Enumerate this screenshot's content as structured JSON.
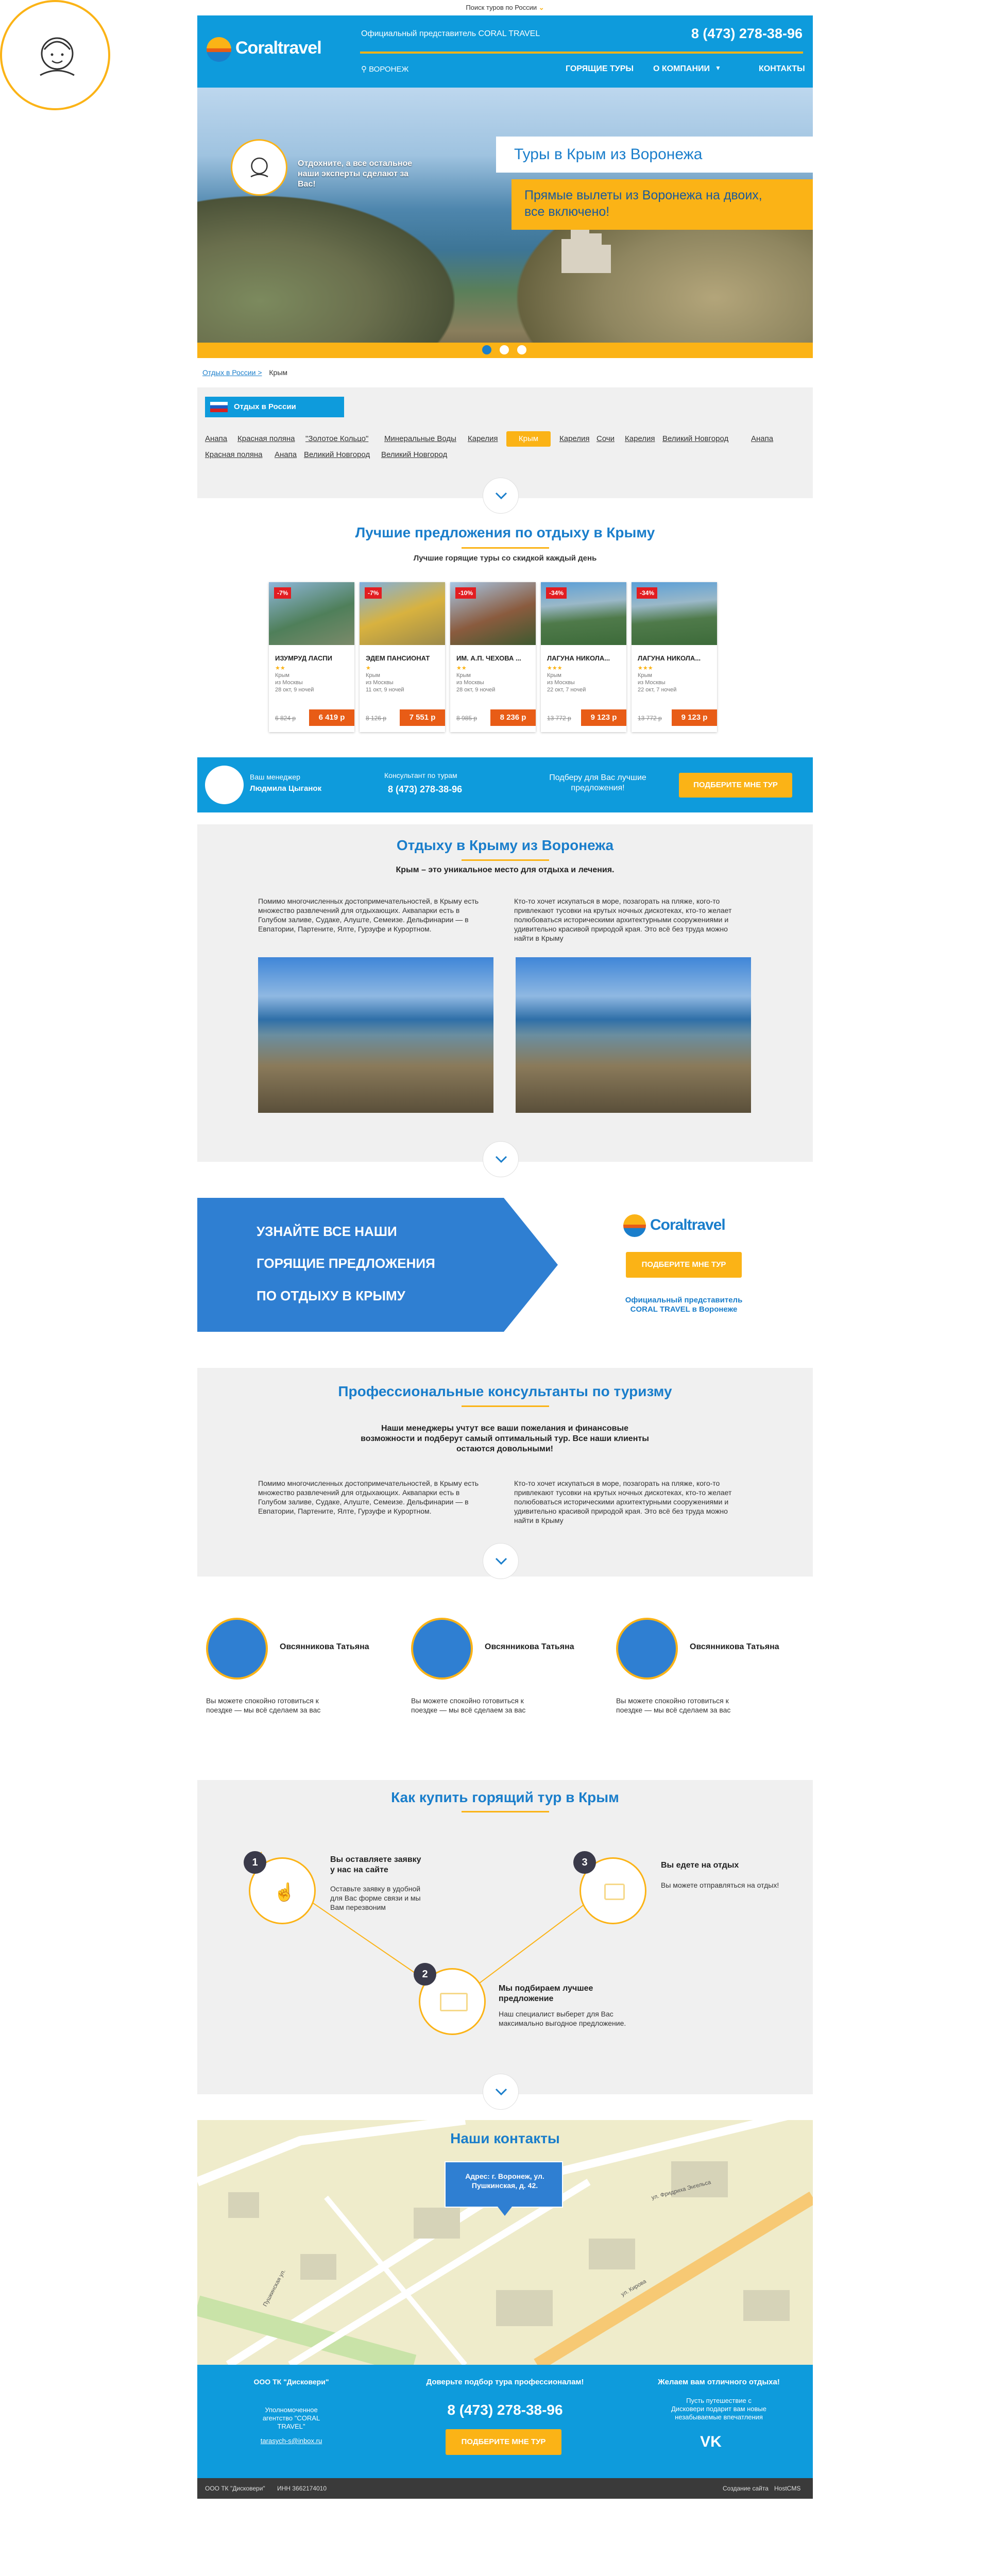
{
  "topbar": {
    "search_label": "Поиск туров по России"
  },
  "header": {
    "logo": "Coraltravel",
    "official": "Официальный представитель CORAL TRAVEL",
    "phone": "8 (473) 278-38-96",
    "city": "ВОРОНЕЖ",
    "nav": [
      "ГОРЯЩИЕ ТУРЫ",
      "О КОМПАНИИ",
      "КОНТАКТЫ"
    ]
  },
  "hero": {
    "title": "Туры в Крым из Воронежа",
    "subtitle": "Прямые вылеты из Воронежа на двоих, все включено!",
    "consult": "Отдохните, а все остальное наши эксперты сделают за Вас!"
  },
  "breadcrumb": {
    "home": "Отдых в России >",
    "current": "Крым"
  },
  "filters": {
    "title": "Отдых в России",
    "row1": [
      "Анапа",
      "Красная поляна",
      "\"Золотое Кольцо\"",
      "Минеральные Воды",
      "Карелия",
      "Крым",
      "Карелия",
      "Сочи",
      "Карелия",
      "Великий Новгород",
      "Анапа"
    ],
    "row2": [
      "Красная поляна",
      "Анапа",
      "Великий Новгород",
      "Великий Новгород"
    ]
  },
  "offers": {
    "title": "Лучшие предложения по отдыху в Крыму",
    "subtitle": "Лучшие горящие туры со скидкой каждый день",
    "cards": [
      {
        "disc": "-7%",
        "name": "ИЗУМРУД ЛАСПИ",
        "stars": "★★",
        "meta1": "Крым",
        "meta2": "из Москвы",
        "meta3": "28 окт, 9 ночей",
        "old": "6 824 р",
        "price": "6 419 р"
      },
      {
        "disc": "-7%",
        "name": "ЭДЕМ ПАНСИОНАТ",
        "stars": "★",
        "meta1": "Крым",
        "meta2": "из Москвы",
        "meta3": "11 окт, 9 ночей",
        "old": "8 126 р",
        "price": "7 551 р"
      },
      {
        "disc": "-10%",
        "name": "ИМ. А.П. ЧЕХОВА ...",
        "stars": "★★",
        "meta1": "Крым",
        "meta2": "из Москвы",
        "meta3": "28 окт, 9 ночей",
        "old": "8 985 р",
        "price": "8 236 р"
      },
      {
        "disc": "-34%",
        "name": "ЛАГУНА НИКОЛА...",
        "stars": "★★★",
        "meta1": "Крым",
        "meta2": "из Москвы",
        "meta3": "22 окт, 7 ночей",
        "old": "13 772 р",
        "price": "9 123 р"
      },
      {
        "disc": "-34%",
        "name": "ЛАГУНА НИКОЛА...",
        "stars": "★★★",
        "meta1": "Крым",
        "meta2": "из Москвы",
        "meta3": "22 окт, 7 ночей",
        "old": "13 772 р",
        "price": "9 123 р"
      }
    ]
  },
  "manager": {
    "label": "Ваш менеджер",
    "name": "Людмила Цыганок",
    "consult_label": "Консультант по турам",
    "phone": "8 (473) 278-38-96",
    "pitch": "Подберу для Вас лучшие предложения!",
    "button": "ПОДБЕРИТЕ МНЕ ТУР"
  },
  "about": {
    "title": "Отдыху в Крыму из Воронежа",
    "subtitle": "Крым – это  уникальное место для отдыха и лечения.",
    "left": "Помимо многочисленных достопримечательностей, в Крыму есть множество развлечений для отдыхающих. Аквапарки есть в Голубом заливе, Судаке, Алуште, Семеизе. Дельфинарии — в Евпатории, Партените, Ялте, Гурзуфе и Курортном.",
    "right": "Кто-то хочет искупаться в море, позагорать на пляже, кого-то привлекают тусовки на крутых ночных дискотеках, кто-то желает полюбоваться историческими архитектурными сооружениями и удивительно красивой природой края. Это всё без труда можно найти в Крыму"
  },
  "promo": {
    "lines": [
      "УЗНАЙТЕ ВСЕ НАШИ",
      "ГОРЯЩИЕ ПРЕДЛОЖЕНИЯ",
      "ПО ОТДЫХУ В КРЫМУ"
    ],
    "logo": "Coraltravel",
    "button": "ПОДБЕРИТЕ МНЕ ТУР",
    "rep": "Официальный представитель CORAL TRAVEL в Воронеже"
  },
  "consultants": {
    "title": "Профессиональные консультанты по туризму",
    "subtitle": "Наши менеджеры учтут все ваши пожелания и финансовые возможности и подберут самый оптимальный тур. Все наши клиенты остаются довольными!",
    "left": "Помимо многочисленных достопримечательностей, в Крыму есть множество развлечений для отдыхающих. Аквапарки есть в Голубом заливе, Судаке, Алуште, Семеизе. Дельфинарии — в Евпатории, Партените, Ялте, Гурзуфе и Курортном.",
    "right": "Кто-то хочет искупаться в море, позагорать на пляже, кого-то привлекают тусовки на крутых ночных дискотеках, кто-то желает полюбоваться историческими архитектурными сооружениями и удивительно красивой природой края. Это всё без труда можно найти в Крыму",
    "people": [
      {
        "name": "Овсянникова Татьяна",
        "text": "Вы можете спокойно готовиться к поездке — мы всё сделаем за вас"
      },
      {
        "name": "Овсянникова Татьяна",
        "text": "Вы можете спокойно готовиться к поездке — мы всё сделаем за вас"
      },
      {
        "name": "Овсянникова Татьяна",
        "text": "Вы можете спокойно готовиться к поездке — мы всё сделаем за вас"
      }
    ]
  },
  "howto": {
    "title": "Как купить горящий тур в Крым",
    "steps": [
      {
        "num": "1",
        "title": "Вы оставляете заявку у нас на сайте",
        "text": "Оставьте заявку в удобной для Вас форме связи и мы Вам перезвоним"
      },
      {
        "num": "2",
        "title": "Мы подбираем лучшее предложение",
        "text": "Наш специалист выберет для Вас максимально выгодное предложение."
      },
      {
        "num": "3",
        "title": "Вы едете на отдых",
        "text": "Вы можете отправляться на отдых!"
      }
    ]
  },
  "contacts": {
    "title": "Наши контакты",
    "address": "Адрес: г. Воронеж, ул. Пушкинская, д. 42.",
    "streets": [
      "Пушкинская ул.",
      "ул. Кирова",
      "ул. Фридриха Энгельса"
    ]
  },
  "footer": {
    "company": "ООО ТК \"Дисковери\"",
    "agency": "Уполномоченное агентство \"CORAL TRAVEL\"",
    "email": "tarasych-s@inbox.ru",
    "trust": "Доверьте подбор тура профессионалам!",
    "phone": "8 (473) 278-38-96",
    "button": "ПОДБЕРИТЕ МНЕ ТУР",
    "wish": "Желаем вам отличного отдыха!",
    "wish_text": "Пусть путешествие с Дисковери подарит вам новые незабываемые впечатления",
    "vk": "VK",
    "bottom_company": "ООО ТК \"Дисковери\"",
    "inn": "ИНН 3662174010",
    "made": "Создание сайта",
    "cms": "HostCMS"
  }
}
